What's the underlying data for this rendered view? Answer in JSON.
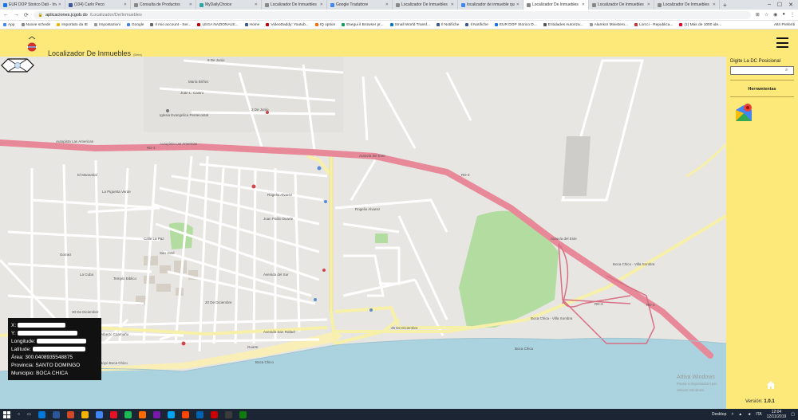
{
  "browser": {
    "tabs": [
      {
        "label": "EUR DOP Storico Dati - Investi",
        "color": "#1a73e8"
      },
      {
        "label": "(104) Carlo Peco",
        "color": "#3b5998"
      },
      {
        "label": "Consulta de Productos",
        "color": "#888888"
      },
      {
        "label": "MyDailyChoice",
        "color": "#2ba5a5"
      },
      {
        "label": "Localizador De Inmuebles",
        "color": "#888888"
      },
      {
        "label": "Google Traduttore",
        "color": "#4285f4"
      },
      {
        "label": "Localizador De Inmuebles",
        "color": "#888888"
      },
      {
        "label": "localizador de inmueble que n",
        "color": "#4285f4"
      },
      {
        "label": "Localizador De Inmuebles",
        "color": "#888888",
        "active": true
      },
      {
        "label": "Localizador De Inmuebles",
        "color": "#888888"
      },
      {
        "label": "Localizador De Inmuebles",
        "color": "#888888"
      }
    ],
    "new_tab": "+",
    "url_host": "aplicaciones.jcgob.do",
    "url_path": "/Localizador/De/Inmuebles",
    "bookmarks": [
      {
        "label": "App",
        "color": "#4285f4"
      },
      {
        "label": "Nuove schede",
        "color": "#888888"
      },
      {
        "label": "Importato da IE",
        "color": "#f4b400"
      },
      {
        "label": "Impostazioni",
        "color": "#999999"
      },
      {
        "label": "Google",
        "color": "#4285f4"
      },
      {
        "label": "Il mio account - Ser...",
        "color": "#666666"
      },
      {
        "label": "LEGA NAZIONALE...",
        "color": "#cc0000"
      },
      {
        "label": "Home",
        "color": "#3b5998"
      },
      {
        "label": "VideoDaddy: Youtub...",
        "color": "#cc0000"
      },
      {
        "label": "IQ option",
        "color": "#ff6a00"
      },
      {
        "label": "Esegui il Browser pr...",
        "color": "#0f9d58"
      },
      {
        "label": "Small World Transf...",
        "color": "#0077cc"
      },
      {
        "label": "Il Notifiche",
        "color": "#3b5998"
      },
      {
        "label": "Il Notifiche",
        "color": "#3b5998"
      },
      {
        "label": "EUR DOP Storico D...",
        "color": "#1a73e8"
      },
      {
        "label": "Entidades Autoriza...",
        "color": "#555555"
      },
      {
        "label": "Alamkor Ministero...",
        "color": "#999999"
      },
      {
        "label": "Lorcci - Republica...",
        "color": "#cc3333"
      },
      {
        "label": "(1) Más de 1000 ide...",
        "color": "#e60023"
      }
    ],
    "other_bookmarks": "Altri Preferiti"
  },
  "app": {
    "title": "Localizador De Inmuebles",
    "beta": "(Beta)",
    "panel_title": "Digite La DC Posicional",
    "search_value": "",
    "tools_title": "Herramientas",
    "version_label": "Versión:",
    "version_value": "1.0.1"
  },
  "info": {
    "x_label": "X:",
    "y_label": "Y:",
    "lon_label": "Longitude:",
    "lat_label": "Latitude:",
    "area": "Área: 300.0408935548875",
    "provincia": "Provincia: SANTO DOMINGO",
    "municipio": "Municipio: BOCA CHICA"
  },
  "map_labels": {
    "autopista": "Autopista Las Americas",
    "autopista2": "Autopista Las Americas",
    "autovia": "Autovía del Este",
    "autovia2": "Autovía del Este",
    "rd3a": "RD-3",
    "rd3b": "RD-3",
    "rd3c": "RD-3",
    "rd3d": "RD-3",
    "de_junio": "6 De Junio",
    "de_junio2": "2 De Junio",
    "maria_brinez": "María Briñez",
    "juan_castro": "Juan L. Castro",
    "iglesia": "Iglesia Evangelica Pentecostal",
    "rogelio1": "Rogelio Alvarez",
    "rogelio2": "Rogelio Alvarez",
    "san_jose": "Juan Pablo Duarte",
    "avenida_sol": "Avenida del Sur",
    "dic30": "30 De Diciembre",
    "dic20": "20 De Diciembre",
    "dic25": "25 De Diciembre",
    "alberto_caamano": "Calle Alberto Caamaño",
    "av_san_rafael": "Avenida San Rafael",
    "duarte": "Duarte",
    "boca_chico": "Boca Chico",
    "boca_chica": "Boca Chica",
    "hoyo": "Hoyo Boca Chico",
    "la_piguetta": "La Piguetta Verde",
    "templo": "Templo Biblico",
    "boca_chico_road": "Boca Chico - Villa Sombra",
    "boca_chica_road2": "Boca Chica - Villa Sombra",
    "el_manantial": "El Manantial",
    "gomez": "Gomez",
    "la_cuba": "La Cuba",
    "san_jose_ave": "San José",
    "calle_la_paz": "Calle La Paz"
  },
  "watermark": {
    "line1": "Attiva Windows",
    "line2": "Passa a Impostazioni per attivare Windows."
  },
  "taskbar": {
    "lang": "ITA",
    "time": "12:04",
    "date": "12/11/2019",
    "desktop": "Desktop"
  },
  "colors": {
    "header": "#fde97a",
    "highway": "#e8899a",
    "primary": "#f7f0a8",
    "park": "#b3dca0",
    "sea": "#aad3df",
    "beach": "#f9eeb6"
  }
}
